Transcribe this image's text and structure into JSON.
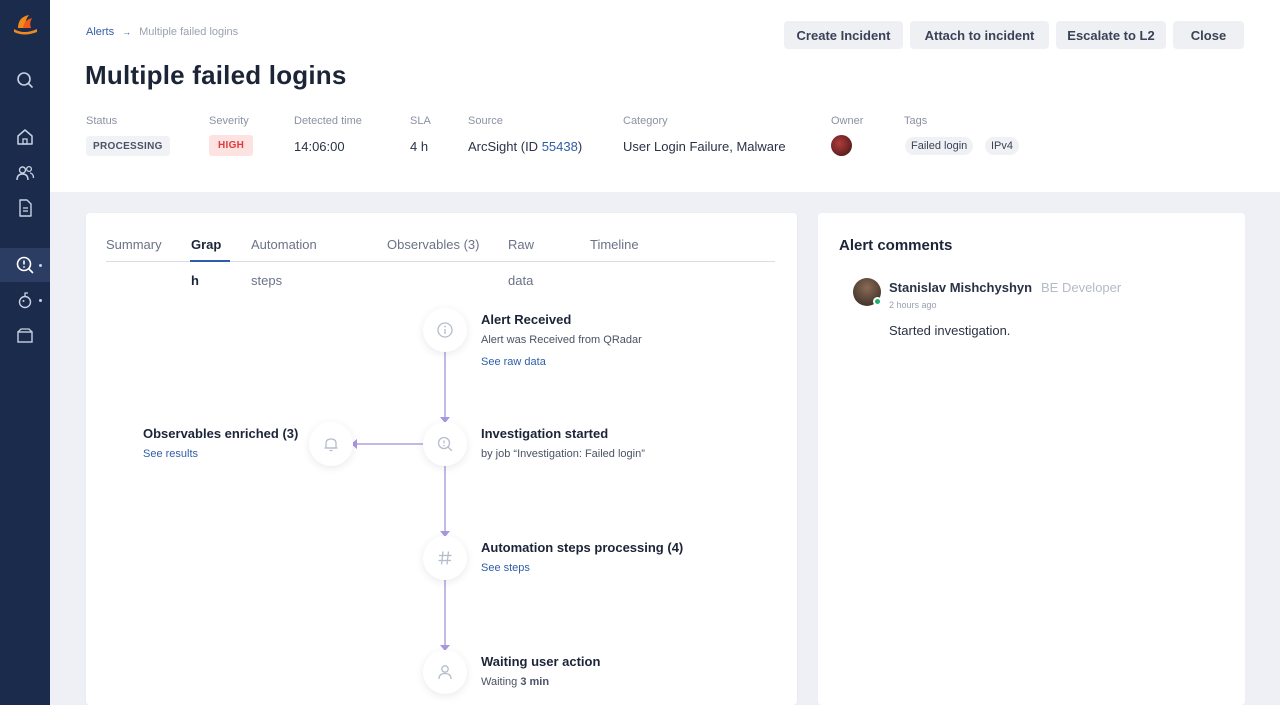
{
  "breadcrumb": {
    "parent": "Alerts",
    "separator": "→",
    "current": "Multiple failed logins"
  },
  "title": "Multiple failed logins",
  "actions": {
    "create_incident": "Create Incident",
    "attach_to_incident": "Attach to incident",
    "escalate": "Escalate to L2",
    "close": "Close"
  },
  "meta": {
    "status_label": "Status",
    "status_value": "PROCESSING",
    "severity_label": "Severity",
    "severity_value": "HIGH",
    "detected_label": "Detected time",
    "detected_value": "14:06:00",
    "sla_label": "SLA",
    "sla_value": "4 h",
    "source_label": "Source",
    "source_prefix": "ArcSight (ID ",
    "source_id": "55438",
    "source_suffix": ")",
    "category_label": "Category",
    "category_value": "User Login Failure, Malware",
    "owner_label": "Owner",
    "tags_label": "Tags",
    "tags": [
      "Failed login",
      "IPv4"
    ]
  },
  "tabs": {
    "summary": "Summary",
    "graph_line1": "Grap",
    "graph_line2": "h",
    "automation_line1": "Automation",
    "automation_line2": "steps",
    "observables": "Observables (3)",
    "raw_line1": "Raw",
    "raw_line2": "data",
    "timeline": "Timeline"
  },
  "graph": {
    "alert_received": {
      "title": "Alert Received",
      "subtitle": "Alert was Received from QRadar",
      "link": "See raw data"
    },
    "investigation": {
      "title": "Investigation started",
      "subtitle": "by job “Investigation: Failed login”"
    },
    "observables": {
      "title": "Observables enriched (3)",
      "link": "See results"
    },
    "automation": {
      "title": "Automation steps processing (4)",
      "link": "See steps"
    },
    "waiting": {
      "title": "Waiting user action",
      "subtitle_prefix": "Waiting ",
      "subtitle_value": "3 min"
    }
  },
  "comments": {
    "title": "Alert comments",
    "items": [
      {
        "author": "Stanislav Mishchyshyn",
        "role": "BE Developer",
        "time": "2 hours ago",
        "text": "Started investigation."
      }
    ]
  },
  "colors": {
    "sidebar": "#1a2b4c",
    "accent": "#2f5ea8",
    "severity_high": "#e03b3b",
    "graph_line": "#c3b8e6"
  }
}
